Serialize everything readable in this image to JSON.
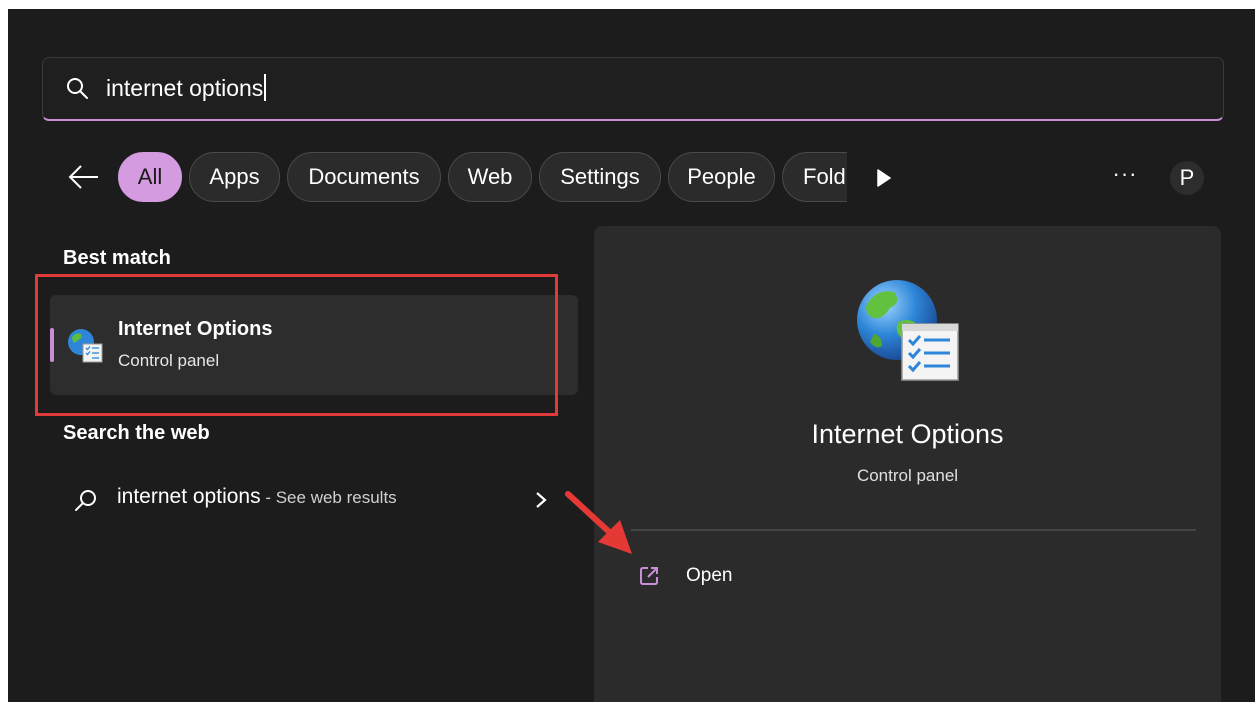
{
  "search": {
    "query": "internet options",
    "search_icon": "search-icon"
  },
  "filters": {
    "back_icon": "back-arrow-icon",
    "chips": [
      "All",
      "Apps",
      "Documents",
      "Web",
      "Settings",
      "People",
      "Fold"
    ],
    "active": "All",
    "more_icon": "play-icon",
    "ellipsis": "···",
    "avatar_initial": "P"
  },
  "left": {
    "best_match_title": "Best match",
    "best_match": {
      "title": "Internet Options",
      "subtitle": "Control panel",
      "icon": "internet-options-icon"
    },
    "search_web_title": "Search the web",
    "web_result": {
      "query": "internet options",
      "hint": " - See web results",
      "icon": "search-icon",
      "chevron": "chevron-right-icon"
    }
  },
  "preview": {
    "title": "Internet Options",
    "subtitle": "Control panel",
    "actions": [
      {
        "label": "Open",
        "icon": "open-external-icon"
      }
    ]
  },
  "colors": {
    "accent": "#d49be0",
    "background": "#1c1c1c",
    "panel": "#2b2b2b",
    "annotation_red": "#e03a3a"
  }
}
